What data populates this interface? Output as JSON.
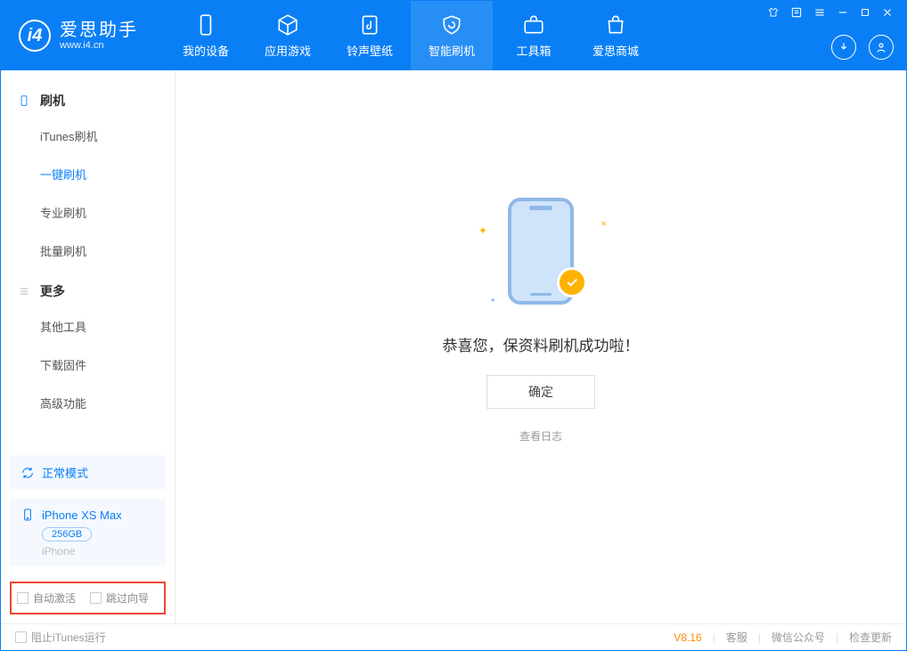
{
  "app": {
    "title": "爱思助手",
    "subtitle": "www.i4.cn"
  },
  "tabs": {
    "device": "我的设备",
    "apps": "应用游戏",
    "ringtones": "铃声壁纸",
    "flash": "智能刷机",
    "tools": "工具箱",
    "store": "爱思商城"
  },
  "sidebar": {
    "flash_header": "刷机",
    "items": {
      "itunes": "iTunes刷机",
      "oneclick": "一键刷机",
      "pro": "专业刷机",
      "batch": "批量刷机"
    },
    "more_header": "更多",
    "more": {
      "other_tools": "其他工具",
      "firmware": "下载固件",
      "advanced": "高级功能"
    }
  },
  "mode_card": {
    "label": "正常模式"
  },
  "device_card": {
    "name": "iPhone XS Max",
    "capacity": "256GB",
    "type": "iPhone"
  },
  "bottom_options": {
    "auto_activate": "自动激活",
    "skip_guide": "跳过向导"
  },
  "main": {
    "success_msg": "恭喜您，保资料刷机成功啦！",
    "ok": "确定",
    "view_log": "查看日志"
  },
  "footer": {
    "block_itunes": "阻止iTunes运行",
    "version": "V8.16",
    "support": "客服",
    "wechat": "微信公众号",
    "update": "检查更新"
  }
}
